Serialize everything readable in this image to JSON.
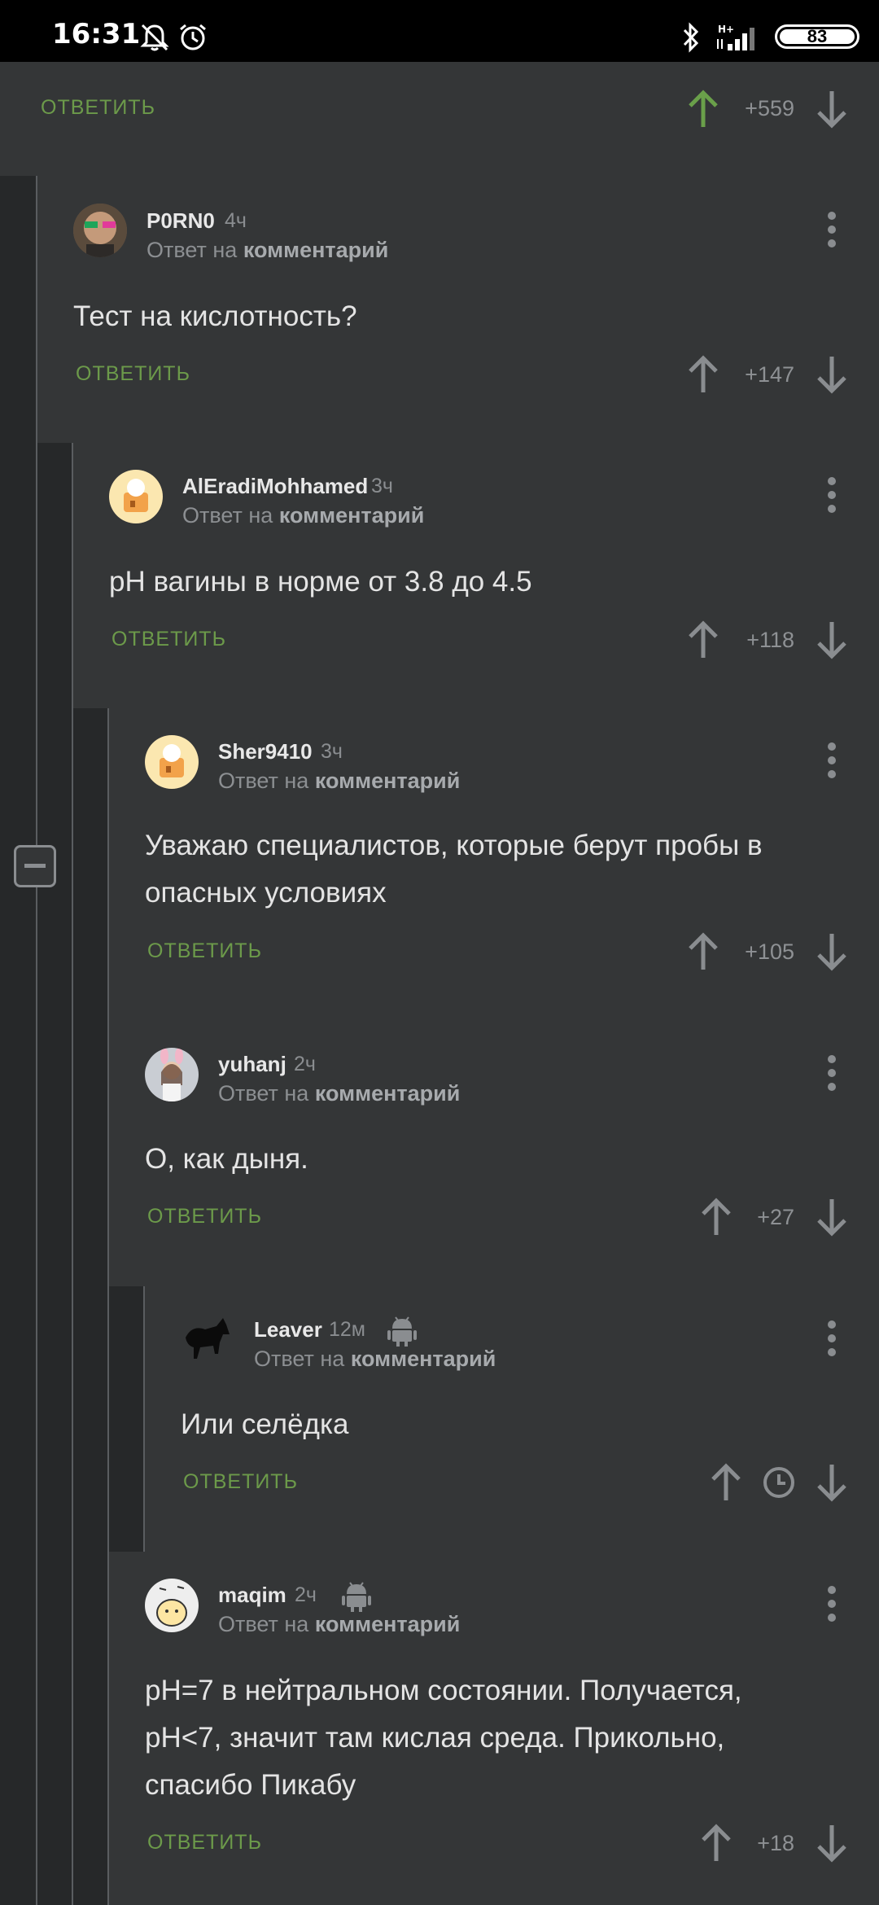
{
  "status_bar": {
    "time": "16:31",
    "battery": "83"
  },
  "top_item": {
    "reply": "ОТВЕТИТЬ",
    "score": "+559"
  },
  "comments": [
    {
      "author": "P0RN0",
      "time": "4ч",
      "reply_to_prefix": "Ответ на",
      "reply_to_link": "комментарий",
      "text": "Тест на кислотность?",
      "reply": "ОТВЕТИТЬ",
      "score": "+147"
    },
    {
      "author": "AlEradiMohhamed",
      "time": "3ч",
      "reply_to_prefix": "Ответ на",
      "reply_to_link": "комментарий",
      "text": "pH вагины в норме от 3.8 до 4.5",
      "reply": "ОТВЕТИТЬ",
      "score": "+118"
    },
    {
      "author": "Sher9410",
      "time": "3ч",
      "reply_to_prefix": "Ответ на",
      "reply_to_link": "комментарий",
      "text_lines": [
        "Уважаю специалистов, которые берут пробы в",
        "опасных условиях"
      ],
      "reply": "ОТВЕТИТЬ",
      "score": "+105"
    },
    {
      "author": "yuhanj",
      "time": "2ч",
      "reply_to_prefix": "Ответ на",
      "reply_to_link": "комментарий",
      "text": "О, как дыня.",
      "reply": "ОТВЕТИТЬ",
      "score": "+27"
    },
    {
      "author": "Leaver",
      "time": "12м",
      "reply_to_prefix": "Ответ на",
      "reply_to_link": "комментарий",
      "text": "Или селёдка",
      "reply": "ОТВЕТИТЬ"
    },
    {
      "author": "maqim",
      "time": "2ч",
      "reply_to_prefix": "Ответ на",
      "reply_to_link": "комментарий",
      "text_lines": [
        "pH=7 в нейтральном состоянии. Получается,",
        "pH<7, значит там кислая среда. Прикольно,",
        "спасибо Пикабу"
      ],
      "reply": "ОТВЕТИТЬ",
      "score": "+18"
    }
  ],
  "colors": {
    "accent_green": "#6c9a4a",
    "upvoted_green": "#6aa04a",
    "background": "#343637"
  }
}
